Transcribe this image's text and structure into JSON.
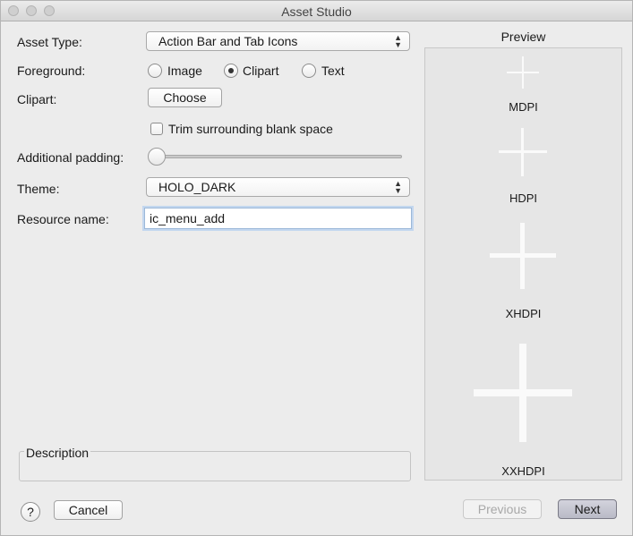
{
  "window": {
    "title": "Asset Studio"
  },
  "form": {
    "asset_type": {
      "label": "Asset Type:",
      "value": "Action Bar and Tab Icons"
    },
    "foreground": {
      "label": "Foreground:",
      "options": [
        "Image",
        "Clipart",
        "Text"
      ],
      "selected": "Clipart"
    },
    "clipart": {
      "label": "Clipart:",
      "button_label": "Choose"
    },
    "trim": {
      "label": "Trim surrounding blank space",
      "checked": false
    },
    "padding": {
      "label": "Additional padding:",
      "value_percent": 0
    },
    "theme": {
      "label": "Theme:",
      "value": "HOLO_DARK"
    },
    "resource_name": {
      "label": "Resource name:",
      "value": "ic_menu_add"
    },
    "description": {
      "label": "Description"
    }
  },
  "preview": {
    "title": "Preview",
    "densities": [
      "MDPI",
      "HDPI",
      "XHDPI",
      "XXHDPI"
    ]
  },
  "footer": {
    "help_label": "?",
    "cancel_label": "Cancel",
    "previous_label": "Previous",
    "next_label": "Next"
  },
  "icons": {
    "window_controls": [
      "close-icon",
      "minimize-icon",
      "zoom-icon"
    ],
    "preview_icon": "plus-icon"
  }
}
